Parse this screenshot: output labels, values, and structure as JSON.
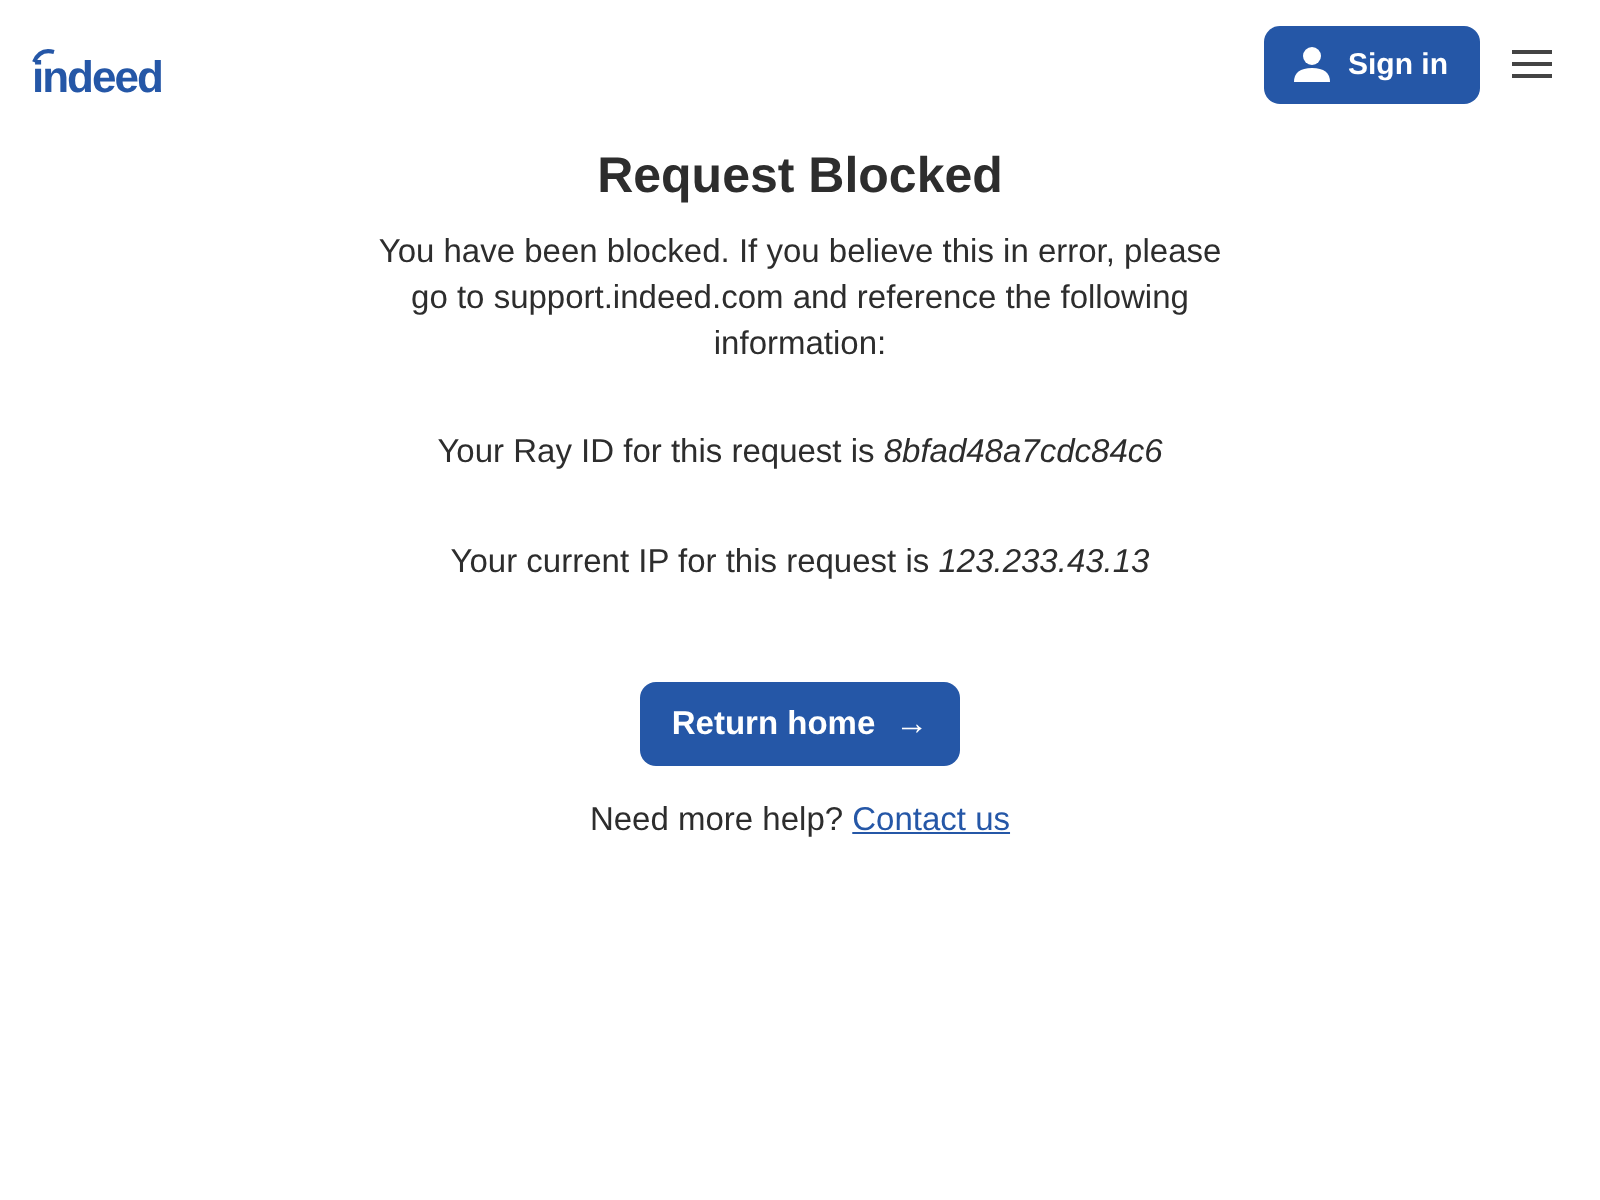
{
  "header": {
    "logo": "indeed",
    "sign_in": "Sign in"
  },
  "main": {
    "title": "Request Blocked",
    "paragraphs": [
      "You have been blocked. If you believe this in error, please go to support.indeed.com and reference the following information:",
      "Your Ray ID for this request is *8bfad48a7cdc84c6*",
      "Your current IP for this request is *123.233.43.13*"
    ],
    "button": {
      "label": "Return home",
      "arrow": "→"
    },
    "help": {
      "text": "Need more help?",
      "link": "Contact us"
    }
  }
}
